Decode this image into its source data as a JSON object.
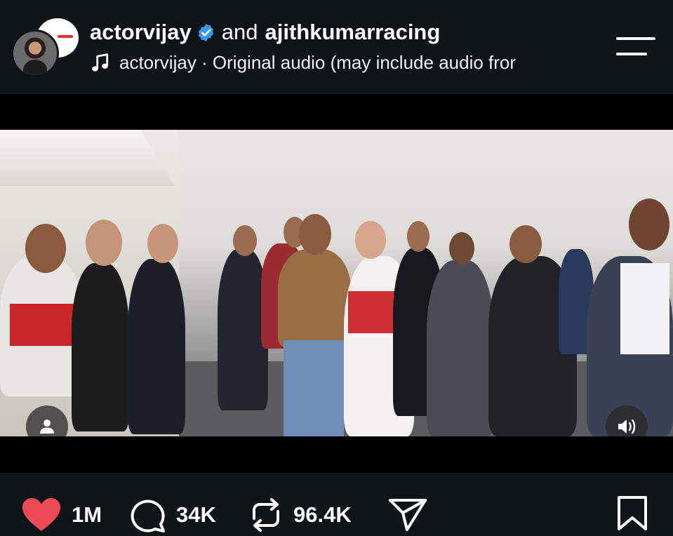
{
  "post": {
    "author": "actorvijay",
    "joiner": "and",
    "coauthor": "ajithkumarracing",
    "audio_line": "actorvijay · Original audio  (may include audio fror"
  },
  "icons": {
    "verified": "verified-badge-icon",
    "audio": "music-note-icon",
    "menu": "menu-icon",
    "user_tag": "user-icon",
    "sound": "speaker-icon",
    "like": "heart-icon",
    "comment": "comment-icon",
    "repost": "repost-icon",
    "share": "send-icon",
    "save": "bookmark-icon"
  },
  "actions": {
    "likes": "1M",
    "comments": "34K",
    "reposts": "96.4K"
  },
  "colors": {
    "background": "#000000",
    "bar": "#0f1419",
    "like": "#ed4956",
    "verified": "#3897f0"
  }
}
